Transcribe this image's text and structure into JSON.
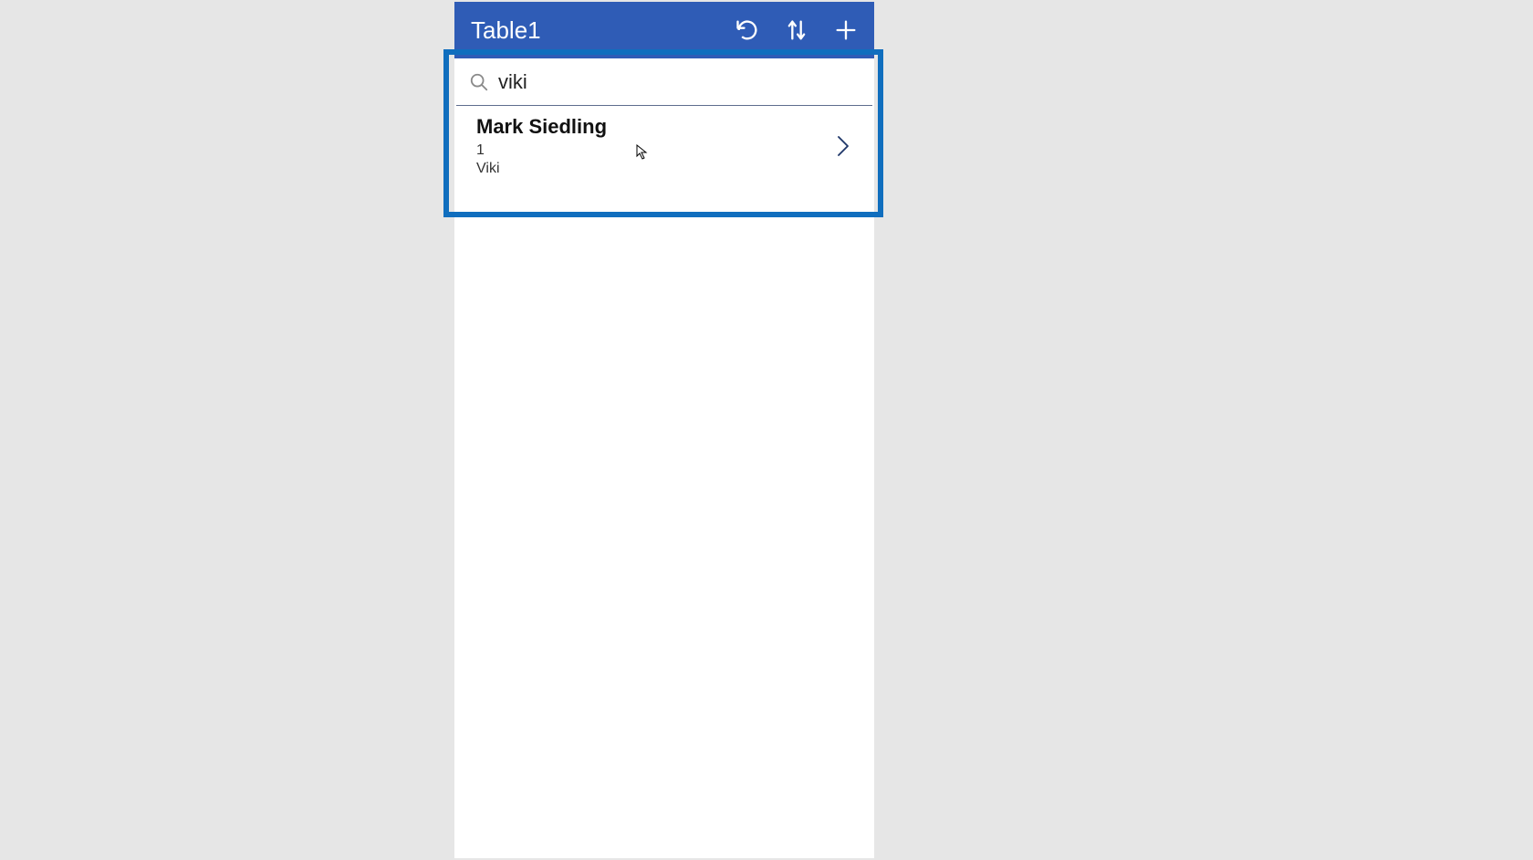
{
  "header": {
    "title": "Table1"
  },
  "search": {
    "value": "viki",
    "placeholder": ""
  },
  "results": [
    {
      "title": "Mark Siedling",
      "line2": "1",
      "line3": "Viki"
    }
  ],
  "colors": {
    "header_bg": "#2f5cb6",
    "highlight": "#106ebe",
    "chevron": "#20386a"
  }
}
